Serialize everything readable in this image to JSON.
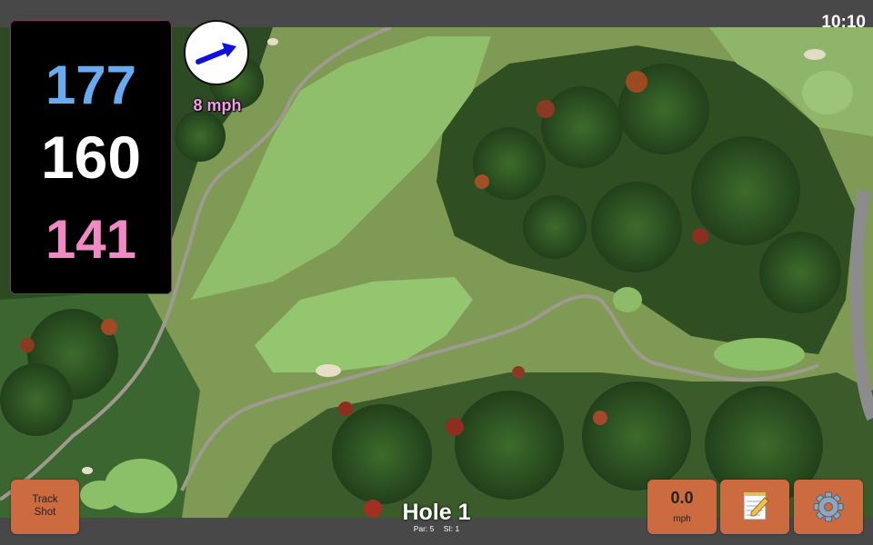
{
  "status": {
    "time": "10:10"
  },
  "distances": {
    "back": "177",
    "middle": "160",
    "front": "141"
  },
  "wind": {
    "speed_label": "8 mph",
    "arrow_icon": "wind-direction-arrow-icon"
  },
  "buttons": {
    "track_shot_line1": "Track",
    "track_shot_line2": "Shot",
    "wind_value": "0.0",
    "wind_unit": "mph",
    "notes_icon": "notepad-icon",
    "settings_icon": "gear-icon"
  },
  "hole": {
    "title": "Hole 1",
    "par": "Par: 5",
    "si": "SI: 1"
  },
  "colors": {
    "accent_button": "#cd6b40",
    "back_distance": "#6aaaf0",
    "middle_distance": "#ffffff",
    "front_distance": "#f08ac4",
    "wind_label": "#f19ae6"
  }
}
